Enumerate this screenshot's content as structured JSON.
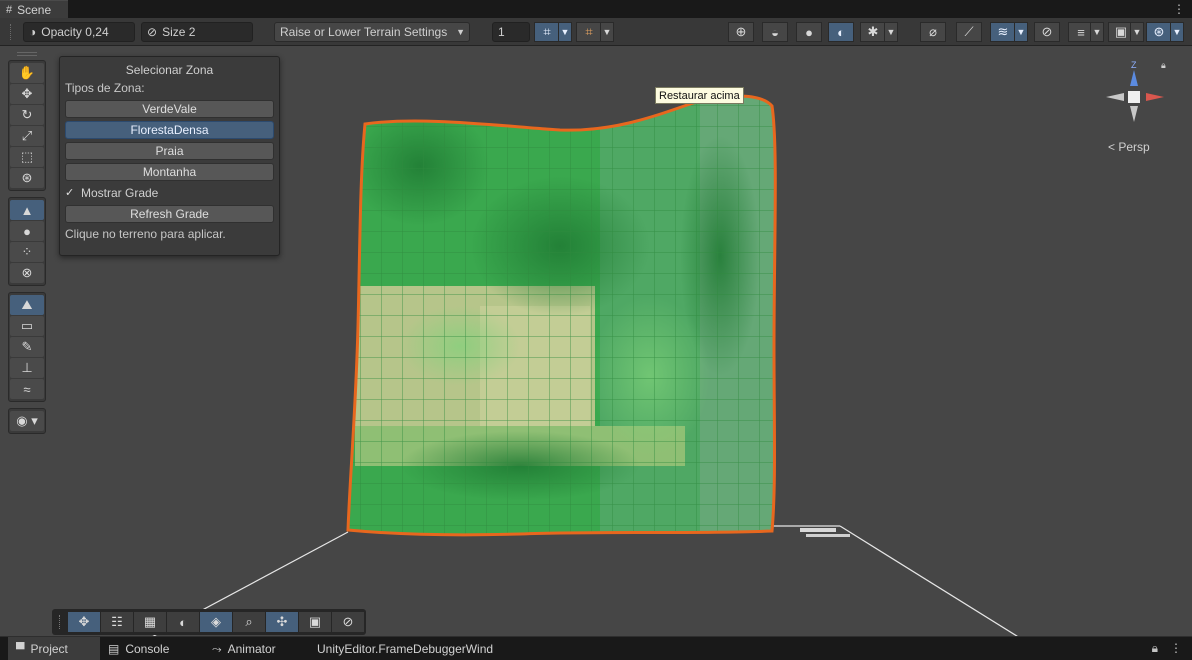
{
  "window": {
    "tab_title": "Scene",
    "menu_icon": "kebab-menu-icon"
  },
  "toolbar": {
    "opacity_label": "Opacity 0,24",
    "size_label": "Size 2",
    "mode_dropdown": "Raise or Lower Terrain Settings",
    "brush_count": "1"
  },
  "zone_panel": {
    "title": "Selecionar Zona",
    "types_label": "Tipos de Zona:",
    "zones": [
      "VerdeVale",
      "FlorestaDensa",
      "Praia",
      "Montanha"
    ],
    "selected_zone": "FlorestaDensa",
    "show_grid_label": "Mostrar Grade",
    "show_grid_checked": true,
    "refresh_label": "Refresh Grade",
    "hint": "Clique no terreno para aplicar."
  },
  "tooltip": {
    "text": "Restaurar acima"
  },
  "gizmo": {
    "axis_label": "Z",
    "projection_label": "Persp"
  },
  "bottom_tabs": [
    {
      "label": "Project",
      "icon": "folder-icon",
      "active": true
    },
    {
      "label": "Console",
      "icon": "console-icon",
      "active": false
    },
    {
      "label": "Animator",
      "icon": "animator-icon",
      "active": false
    },
    {
      "label": "UnityEditor.FrameDebuggerWind",
      "icon": "",
      "active": false
    }
  ],
  "colors": {
    "terrain_green": "#3aa84e",
    "grid_green": "#5dbd5f",
    "sand": "#b6c58a",
    "outline": "#e8671e",
    "accent": "#46607c",
    "viewport_bg": "#464646"
  }
}
